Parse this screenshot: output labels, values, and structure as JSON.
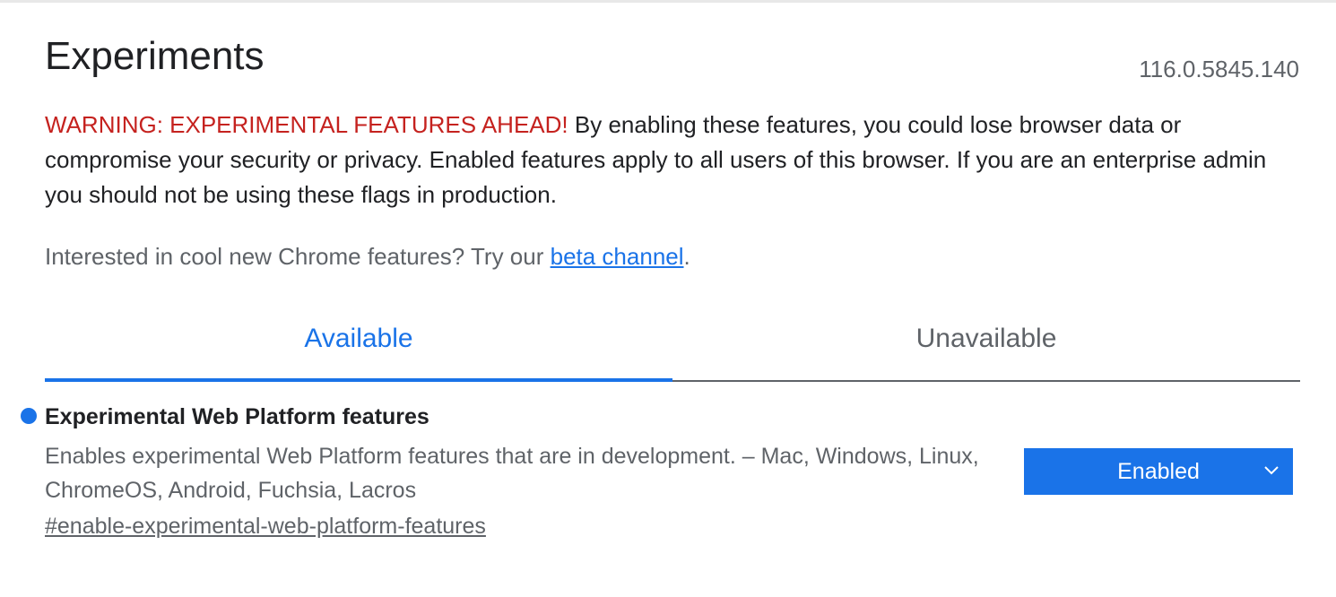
{
  "header": {
    "title": "Experiments",
    "version": "116.0.5845.140"
  },
  "warning": {
    "heading": "WARNING: EXPERIMENTAL FEATURES AHEAD!",
    "body": " By enabling these features, you could lose browser data or compromise your security or privacy. Enabled features apply to all users of this browser. If you are an enterprise admin you should not be using these flags in production."
  },
  "promo": {
    "text": "Interested in cool new Chrome features? Try our ",
    "link_label": "beta channel",
    "suffix": "."
  },
  "tabs": [
    {
      "label": "Available",
      "active": true
    },
    {
      "label": "Unavailable",
      "active": false
    }
  ],
  "experiments": [
    {
      "title": "Experimental Web Platform features",
      "description": "Enables experimental Web Platform features that are in development. – Mac, Windows, Linux, ChromeOS, Android, Fuchsia, Lacros",
      "permalink": "#enable-experimental-web-platform-features",
      "selected_value": "Enabled",
      "modified_indicator": "blue-dot-icon"
    }
  ],
  "colors": {
    "accent": "#1a73e8",
    "warning": "#c5221f",
    "text_primary": "#202124",
    "text_secondary": "#5f6368"
  }
}
